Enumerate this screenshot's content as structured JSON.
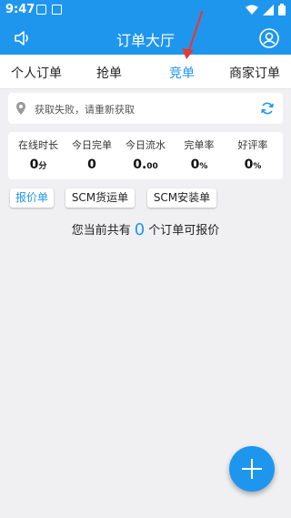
{
  "status_bar": {
    "time": "9:47"
  },
  "app_bar": {
    "title": "订单大厅",
    "left_icon": "speaker-icon",
    "right_icon": "user-icon"
  },
  "tabs": [
    {
      "label": "个人订单",
      "active": false
    },
    {
      "label": "抢单",
      "active": false
    },
    {
      "label": "竞单",
      "active": true
    },
    {
      "label": "商家订单",
      "active": false
    }
  ],
  "location": {
    "text": "获取失败，请重新获取",
    "icon": "location-pin-icon",
    "action_icon": "refresh-icon"
  },
  "stats": [
    {
      "label": "在线时长",
      "value": "0",
      "unit": "分"
    },
    {
      "label": "今日完单",
      "value": "0",
      "unit": ""
    },
    {
      "label": "今日流水",
      "value": "0.",
      "unit": "00"
    },
    {
      "label": "完单率",
      "value": "0",
      "unit": "%"
    },
    {
      "label": "好评率",
      "value": "0",
      "unit": "%"
    }
  ],
  "filters": [
    {
      "label": "报价单",
      "active": true
    },
    {
      "label": "SCM货运单",
      "active": false
    },
    {
      "label": "SCM安装单",
      "active": false
    }
  ],
  "order_count": {
    "prefix": "您当前共有",
    "count": "0",
    "suffix": "个订单可报价"
  },
  "colors": {
    "primary": "#1f96ee",
    "background": "#f0f0f3",
    "annotation": "#e53935"
  }
}
